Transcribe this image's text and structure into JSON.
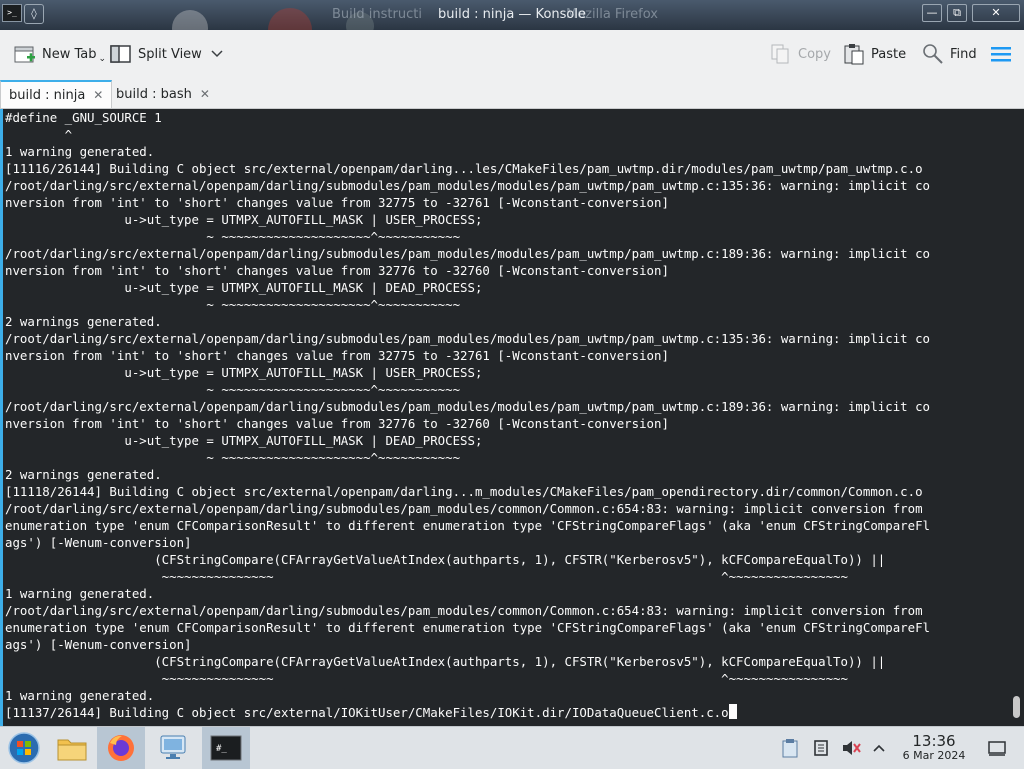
{
  "window": {
    "title": "build : ninja — Konsole",
    "background_title_ghost_left": "Build instructi",
    "background_title_ghost_right": "Mozilla Firefox",
    "buttons": [
      "minimize",
      "maximize",
      "close"
    ]
  },
  "toolbar": {
    "new_tab": "New Tab",
    "split_view": "Split View",
    "copy": "Copy",
    "paste": "Paste",
    "find": "Find"
  },
  "tabs": [
    {
      "label": "build : ninja",
      "active": true
    },
    {
      "label": "build : bash",
      "active": false
    }
  ],
  "terminal": {
    "lines": [
      "#define _GNU_SOURCE 1",
      "        ^",
      "1 warning generated.",
      "[11116/26144] Building C object src/external/openpam/darling...les/CMakeFiles/pam_uwtmp.dir/modules/pam_uwtmp/pam_uwtmp.c.o",
      "/root/darling/src/external/openpam/darling/submodules/pam_modules/modules/pam_uwtmp/pam_uwtmp.c:135:36: warning: implicit co",
      "nversion from 'int' to 'short' changes value from 32775 to -32761 [-Wconstant-conversion]",
      "                u->ut_type = UTMPX_AUTOFILL_MASK | USER_PROCESS;",
      "                           ~ ~~~~~~~~~~~~~~~~~~~~^~~~~~~~~~~~",
      "/root/darling/src/external/openpam/darling/submodules/pam_modules/modules/pam_uwtmp/pam_uwtmp.c:189:36: warning: implicit co",
      "nversion from 'int' to 'short' changes value from 32776 to -32760 [-Wconstant-conversion]",
      "                u->ut_type = UTMPX_AUTOFILL_MASK | DEAD_PROCESS;",
      "                           ~ ~~~~~~~~~~~~~~~~~~~~^~~~~~~~~~~~",
      "2 warnings generated.",
      "/root/darling/src/external/openpam/darling/submodules/pam_modules/modules/pam_uwtmp/pam_uwtmp.c:135:36: warning: implicit co",
      "nversion from 'int' to 'short' changes value from 32775 to -32761 [-Wconstant-conversion]",
      "                u->ut_type = UTMPX_AUTOFILL_MASK | USER_PROCESS;",
      "                           ~ ~~~~~~~~~~~~~~~~~~~~^~~~~~~~~~~~",
      "/root/darling/src/external/openpam/darling/submodules/pam_modules/modules/pam_uwtmp/pam_uwtmp.c:189:36: warning: implicit co",
      "nversion from 'int' to 'short' changes value from 32776 to -32760 [-Wconstant-conversion]",
      "                u->ut_type = UTMPX_AUTOFILL_MASK | DEAD_PROCESS;",
      "                           ~ ~~~~~~~~~~~~~~~~~~~~^~~~~~~~~~~~",
      "2 warnings generated.",
      "[11118/26144] Building C object src/external/openpam/darling...m_modules/CMakeFiles/pam_opendirectory.dir/common/Common.c.o",
      "/root/darling/src/external/openpam/darling/submodules/pam_modules/common/Common.c:654:83: warning: implicit conversion from",
      "enumeration type 'enum CFComparisonResult' to different enumeration type 'CFStringCompareFlags' (aka 'enum CFStringCompareFl",
      "ags') [-Wenum-conversion]",
      "                    (CFStringCompare(CFArrayGetValueAtIndex(authparts, 1), CFSTR(\"Kerberosv5\"), kCFCompareEqualTo)) ||",
      "                     ~~~~~~~~~~~~~~~                                                            ^~~~~~~~~~~~~~~~~",
      "1 warning generated.",
      "/root/darling/src/external/openpam/darling/submodules/pam_modules/common/Common.c:654:83: warning: implicit conversion from",
      "enumeration type 'enum CFComparisonResult' to different enumeration type 'CFStringCompareFlags' (aka 'enum CFStringCompareFl",
      "ags') [-Wenum-conversion]",
      "                    (CFStringCompare(CFArrayGetValueAtIndex(authparts, 1), CFSTR(\"Kerberosv5\"), kCFCompareEqualTo)) ||",
      "                     ~~~~~~~~~~~~~~~                                                            ^~~~~~~~~~~~~~~~~",
      "1 warning generated.",
      "[11137/26144] Building C object src/external/IOKitUser/CMakeFiles/IOKit.dir/IODataQueueClient.c.o"
    ]
  },
  "taskbar": {
    "time": "13:36",
    "date": "6 Mar 2024",
    "apps": [
      "start-menu",
      "file-manager",
      "firefox",
      "network-settings",
      "konsole"
    ]
  },
  "colors": {
    "accent": "#3daee9",
    "terminal_bg": "#232629",
    "terminal_fg": "#fcfcfc"
  }
}
